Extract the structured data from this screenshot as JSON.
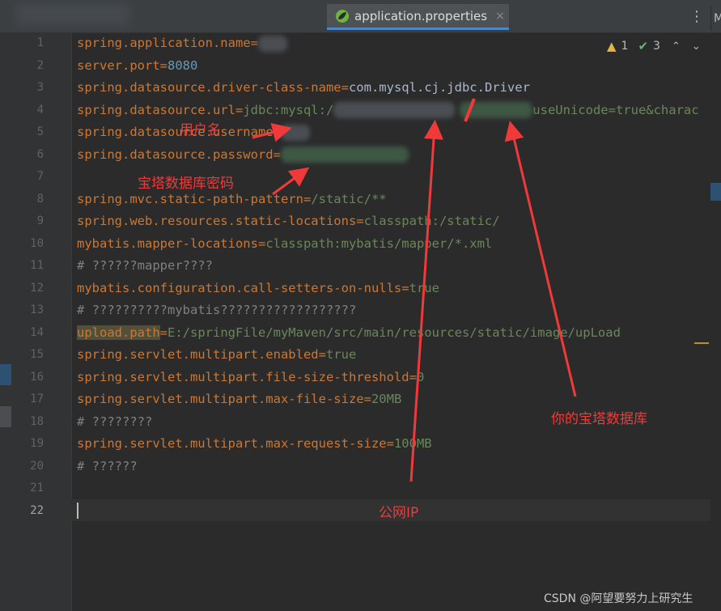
{
  "tab": {
    "filename": "application.properties",
    "close_glyph": "×"
  },
  "toolbar": {
    "more_glyph": "⋮",
    "right_edge": "M"
  },
  "inspections": {
    "warnings": "1",
    "weak_warnings": "3",
    "prev_glyph": "⌃",
    "next_glyph": "⌄"
  },
  "line_numbers": [
    "1",
    "2",
    "3",
    "4",
    "5",
    "6",
    "7",
    "8",
    "9",
    "10",
    "11",
    "12",
    "13",
    "14",
    "15",
    "16",
    "17",
    "18",
    "19",
    "20",
    "21",
    "22"
  ],
  "code": {
    "l1": {
      "key": "spring.application.name",
      "eq": "="
    },
    "l2": {
      "key": "server.port",
      "eq": "=",
      "value": "8080"
    },
    "l3": {
      "key": "spring.datasource.driver-class-name",
      "eq": "=",
      "value": "com.mysql.cj.jdbc.Driver"
    },
    "l4": {
      "key": "spring.datasource.url",
      "eq": "=",
      "value_a": "jdbc:mysql:/",
      "value_b": "useUnicode=true&charac"
    },
    "l5": {
      "key": "spring.datasource.username",
      "eq": "="
    },
    "l6": {
      "key": "spring.datasource.password",
      "eq": "="
    },
    "l8": {
      "key": "spring.mvc.static-path-pattern",
      "eq": "=",
      "value": "/static/**"
    },
    "l9": {
      "key": "spring.web.resources.static-locations",
      "eq": "=",
      "value": "classpath:/static/"
    },
    "l10": {
      "key": "mybatis.mapper-locations",
      "eq": "=",
      "value": "classpath:mybatis/mapper/*.xml"
    },
    "l11": {
      "comment": "# ??????mapper????"
    },
    "l12": {
      "key": "mybatis.configuration.call-setters-on-nulls",
      "eq": "=",
      "value": "true"
    },
    "l13": {
      "comment": "# ??????????mybatis??????????????????"
    },
    "l14": {
      "key": "upload.path",
      "eq": "=",
      "value": "E:/springFile/myMaven/src/main/resources/static/image/upLoad"
    },
    "l15": {
      "key": "spring.servlet.multipart.enabled",
      "eq": "=",
      "value": "true"
    },
    "l16": {
      "key": "spring.servlet.multipart.file-size-threshold",
      "eq": "=",
      "value": "0"
    },
    "l17": {
      "key": "spring.servlet.multipart.max-file-size",
      "eq": "=",
      "value": "20MB"
    },
    "l18": {
      "comment": "# ????????"
    },
    "l19": {
      "key": "spring.servlet.multipart.max-request-size",
      "eq": "=",
      "value": "100MB"
    },
    "l20": {
      "comment": "# ??????"
    }
  },
  "annotations": {
    "username": "用户名",
    "bt_password": "宝塔数据库密码",
    "your_database": "你的宝塔数据库",
    "public_ip": "公网IP"
  },
  "watermark": "CSDN @阿望要努力上研究生",
  "colors": {
    "editor_bg": "#2b2b2b",
    "key_orange": "#cc7832",
    "value_green": "#6a8759",
    "number_blue": "#6897bb",
    "comment_gray": "#808080",
    "annotation_red": "#f03a3a",
    "tab_underline": "#4a88c7"
  }
}
